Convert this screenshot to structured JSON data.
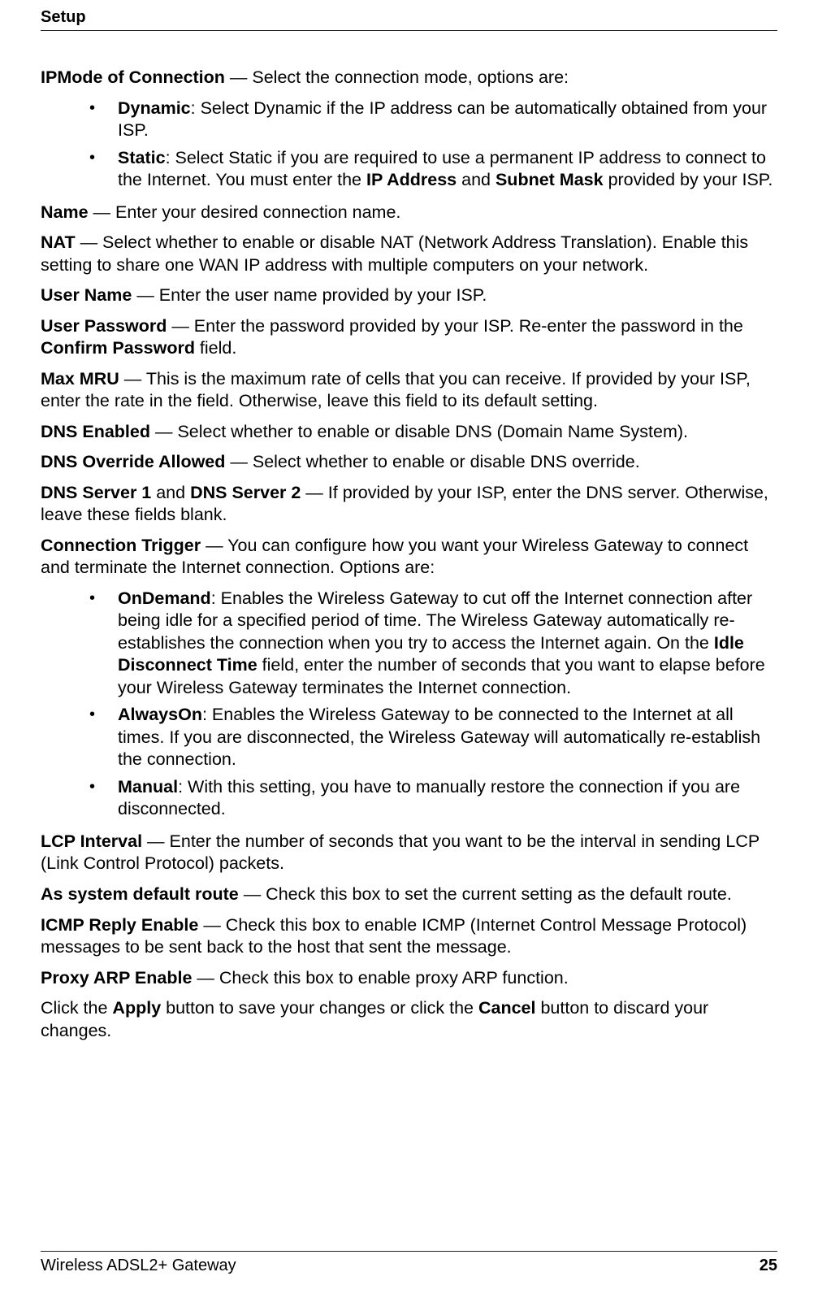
{
  "header": {
    "title": "Setup"
  },
  "p1": {
    "lead": "IPMode of Connection",
    "rest": " — Select the connection mode, options are:"
  },
  "l1": {
    "a_lead": "Dynamic",
    "a_rest": ": Select Dynamic if the IP address can be automatically obtained from your ISP.",
    "b_lead": "Static",
    "b_rest1": ": Select Static if you are required to use a permanent IP address to connect to the Internet. You must enter the ",
    "b_ip": "IP Address",
    "b_mid": " and ",
    "b_sm": "Subnet Mask",
    "b_rest2": " provided by your ISP."
  },
  "p2": {
    "lead": "Name",
    "rest": " — Enter your desired connection name."
  },
  "p3": {
    "lead": "NAT",
    "rest": " — Select whether to enable or disable NAT (Network Address Translation). Enable this setting to share one WAN IP address with multiple computers on your network."
  },
  "p4": {
    "lead": "User Name",
    "rest": " — Enter the user name provided by your ISP."
  },
  "p5": {
    "lead": "User Password",
    "rest1": " — Enter the password provided by your ISP. Re-enter the password in the ",
    "cp": "Confirm Password",
    "rest2": " field."
  },
  "p6": {
    "lead": "Max MRU",
    "rest": " — This is the maximum rate of cells that you can receive. If provided by your ISP, enter the rate in the field. Otherwise, leave this field to its default setting."
  },
  "p7": {
    "lead": "DNS Enabled",
    "rest": " — Select whether to enable or disable DNS (Domain Name System)."
  },
  "p8": {
    "lead": "DNS Override Allowed",
    "rest": " — Select whether to enable or disable DNS override."
  },
  "p9": {
    "lead1": "DNS Server 1",
    "mid": " and ",
    "lead2": "DNS Server 2",
    "rest": " — If provided by your ISP, enter the DNS server. Otherwise, leave these fields blank."
  },
  "p10": {
    "lead": "Connection Trigger",
    "rest": " — You can configure how you want your Wireless Gateway to connect and terminate the Internet connection. Options are:"
  },
  "l2": {
    "a_lead": "OnDemand",
    "a_rest1": ": Enables the Wireless Gateway to cut off the Internet connection after being idle for a specified period of time. The Wireless Gateway automatically re-establishes the connection when you try to access the Internet again. On the ",
    "a_idt": "Idle Disconnect Time",
    "a_rest2": " field, enter the number of seconds that you want to elapse before your Wireless Gateway terminates the Internet connection.",
    "b_lead": "AlwaysOn",
    "b_rest": ": Enables the Wireless Gateway to be connected to the Internet at all times. If you are disconnected, the Wireless Gateway will automatically re-establish the connection.",
    "c_lead": "Manual",
    "c_rest": ": With this setting, you have to manually restore the connection if you are disconnected."
  },
  "p11": {
    "lead": "LCP Interval",
    "rest": " — Enter the number of seconds that you want to be the interval in sending LCP (Link Control Protocol) packets."
  },
  "p12": {
    "lead": "As system default route",
    "rest": " — Check this box to set the current setting as the default route."
  },
  "p13": {
    "lead": "ICMP Reply Enable",
    "rest": " — Check this box to enable ICMP (Internet Control Message Protocol) messages to be sent back to the host that sent the message."
  },
  "p14": {
    "lead": "Proxy ARP Enable",
    "rest": " — Check this box to enable proxy ARP function."
  },
  "p15": {
    "t1": "Click the ",
    "apply": "Apply",
    "t2": " button to save your changes or click the ",
    "cancel": "Cancel",
    "t3": " button to discard your changes."
  },
  "footer": {
    "product": "Wireless ADSL2+ Gateway",
    "page": "25"
  }
}
